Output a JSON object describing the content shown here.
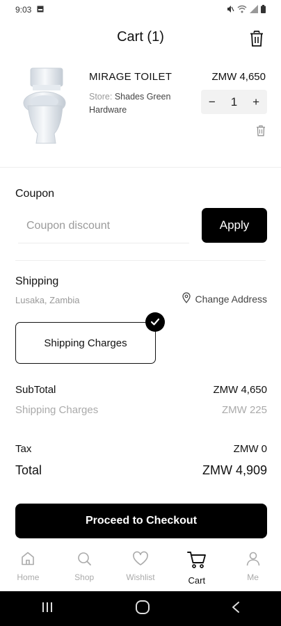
{
  "status_bar": {
    "time": "9:03"
  },
  "header": {
    "title": "Cart (1)"
  },
  "product": {
    "name": "MIRAGE TOILET",
    "store_prefix": "Store: ",
    "store_name": "Shades Green Hardware",
    "price": "ZMW 4,650",
    "quantity": "1",
    "minus": "−",
    "plus": "+"
  },
  "coupon": {
    "label": "Coupon",
    "placeholder": "Coupon discount",
    "apply_label": "Apply"
  },
  "shipping": {
    "label": "Shipping",
    "city": "Lusaka, Zambia",
    "change_address": "Change Address",
    "option_label": "Shipping Charges"
  },
  "totals": {
    "subtotal_label": "SubTotal",
    "subtotal_value": "ZMW 4,650",
    "shipping_label": "Shipping Charges",
    "shipping_value": "ZMW 225",
    "tax_label": "Tax",
    "tax_value": "ZMW 0",
    "total_label": "Total",
    "total_value": "ZMW 4,909"
  },
  "checkout_label": "Proceed to Checkout",
  "nav": {
    "items": [
      {
        "label": "Home",
        "icon": "home-icon"
      },
      {
        "label": "Shop",
        "icon": "search-icon"
      },
      {
        "label": "Wishlist",
        "icon": "heart-icon"
      },
      {
        "label": "Cart",
        "icon": "cart-icon",
        "active": true
      },
      {
        "label": "Me",
        "icon": "user-icon"
      }
    ]
  },
  "colors": {
    "primary": "#000000",
    "muted": "#aaaaaa",
    "background": "#ffffff"
  }
}
